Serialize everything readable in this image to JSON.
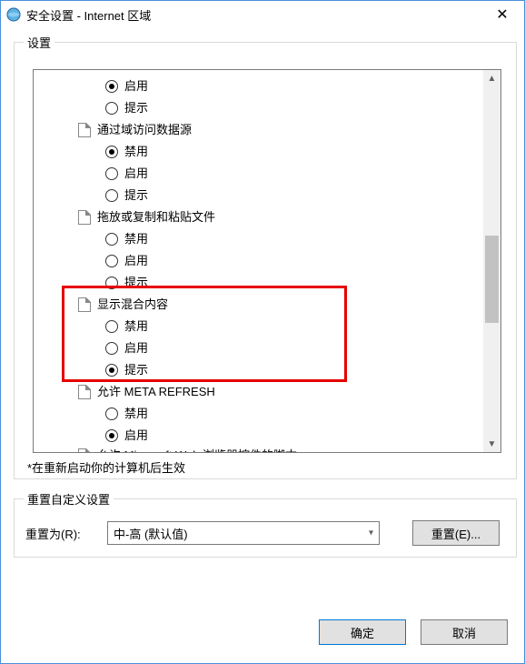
{
  "window": {
    "title": "安全设置 - Internet 区域",
    "close_glyph": "✕"
  },
  "settings": {
    "legend": "设置",
    "note": "*在重新启动你的计算机后生效",
    "rows": [
      {
        "kind": "option",
        "label": "启用",
        "selected": true
      },
      {
        "kind": "option",
        "label": "提示",
        "selected": false
      },
      {
        "kind": "section",
        "label": "通过域访问数据源"
      },
      {
        "kind": "option",
        "label": "禁用",
        "selected": true
      },
      {
        "kind": "option",
        "label": "启用",
        "selected": false
      },
      {
        "kind": "option",
        "label": "提示",
        "selected": false
      },
      {
        "kind": "section",
        "label": "拖放或复制和粘贴文件"
      },
      {
        "kind": "option",
        "label": "禁用",
        "selected": false
      },
      {
        "kind": "option",
        "label": "启用",
        "selected": false
      },
      {
        "kind": "option",
        "label": "提示",
        "selected": false
      },
      {
        "kind": "section",
        "label": "显示混合内容"
      },
      {
        "kind": "option",
        "label": "禁用",
        "selected": false
      },
      {
        "kind": "option",
        "label": "启用",
        "selected": false
      },
      {
        "kind": "option",
        "label": "提示",
        "selected": true
      },
      {
        "kind": "section",
        "label": "允许 META REFRESH"
      },
      {
        "kind": "option",
        "label": "禁用",
        "selected": false
      },
      {
        "kind": "option",
        "label": "启用",
        "selected": true
      },
      {
        "kind": "section_cut",
        "label": "允许 Microsoft Web 浏览器控件的脚本"
      }
    ]
  },
  "reset": {
    "legend": "重置自定义设置",
    "label": "重置为(R):",
    "combo_value": "中-高 (默认值)",
    "button": "重置(E)..."
  },
  "footer": {
    "ok": "确定",
    "cancel": "取消"
  },
  "scrollbar": {
    "up_glyph": "▲",
    "down_glyph": "▼"
  }
}
